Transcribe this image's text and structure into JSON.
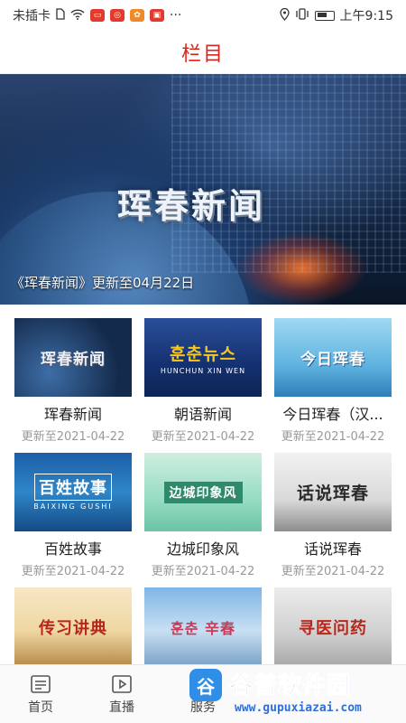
{
  "status_bar": {
    "carrier": "未插卡",
    "time": "上午9:15",
    "more": "···",
    "icons": [
      "sim-icon",
      "wifi-icon",
      "app-icon",
      "app-icon",
      "app-icon",
      "app-icon",
      "location-icon",
      "vibrate-icon",
      "battery-icon"
    ]
  },
  "header": {
    "title": "栏目"
  },
  "banner": {
    "image_text": "珲春新闻",
    "caption": "《珲春新闻》更新至04月22日"
  },
  "programs": [
    {
      "thumb_text": "珲春新闻",
      "title": "珲春新闻",
      "updated": "更新至2021-04-22"
    },
    {
      "thumb_text": "훈춘뉴스",
      "thumb_sub": "HUNCHUN XIN WEN",
      "title": "朝语新闻",
      "updated": "更新至2021-04-22"
    },
    {
      "thumb_text": "今日珲春",
      "title": "今日珲春（汉...",
      "updated": "更新至2021-04-22"
    },
    {
      "thumb_text": "百姓故事",
      "thumb_sub": "BAIXING GUSHI",
      "title": "百姓故事",
      "updated": "更新至2021-04-22"
    },
    {
      "thumb_text": "边城印象风",
      "title": "边城印象风",
      "updated": "更新至2021-04-22"
    },
    {
      "thumb_text": "话说珲春",
      "title": "话说珲春",
      "updated": "更新至2021-04-22"
    },
    {
      "thumb_text": "传习讲典",
      "title": "",
      "updated": ""
    },
    {
      "thumb_text": "훈춘 辛春",
      "title": "",
      "updated": ""
    },
    {
      "thumb_text": "寻医问药",
      "title": "",
      "updated": ""
    }
  ],
  "bottom_nav": [
    {
      "label": "首页",
      "icon": "home-icon"
    },
    {
      "label": "直播",
      "icon": "live-icon"
    },
    {
      "label": "服务",
      "icon": "services-icon"
    }
  ],
  "watermark": {
    "title": "谷普软件园",
    "url": "www.gupuxiazai.com"
  }
}
